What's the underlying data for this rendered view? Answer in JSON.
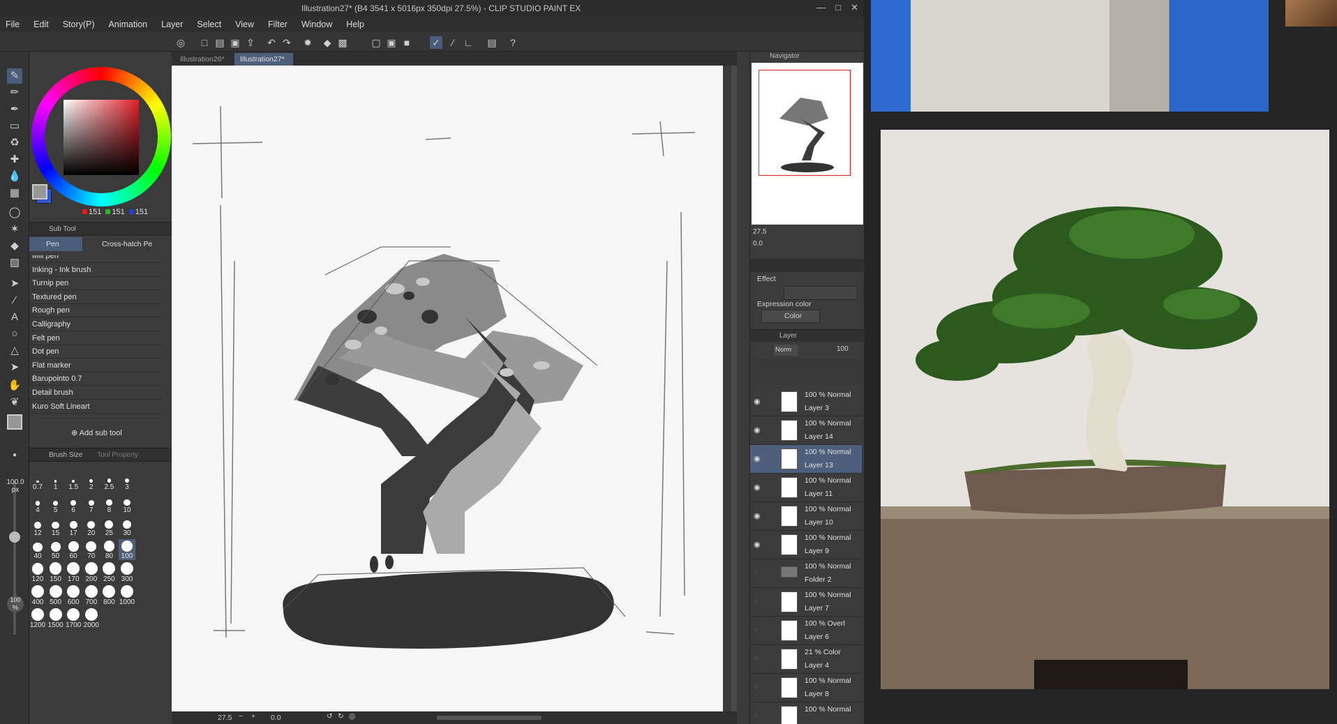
{
  "window": {
    "title": "Illustration27* (B4 3541 x 5016px 350dpi 27.5%) - CLIP STUDIO PAINT EX"
  },
  "menu": [
    "File",
    "Edit",
    "Story(P)",
    "Animation",
    "Layer",
    "Select",
    "View",
    "Filter",
    "Window",
    "Help"
  ],
  "doc_tabs": [
    {
      "label": "Illustration26*",
      "active": false
    },
    {
      "label": "Illustration27*",
      "active": true
    }
  ],
  "color": {
    "r": "151",
    "g": "151",
    "b": "151",
    "main_color": "#979797",
    "sub_color": "#3355cc"
  },
  "sub_tool": {
    "header": "Sub Tool",
    "tabs": [
      "Pen",
      "Cross-hatch Pe"
    ],
    "brushes": [
      "Mili pen",
      "Inking - Ink brush",
      "Turnip pen",
      "Textured pen",
      "Rough pen",
      "Calligraphy",
      "Felt pen",
      "Dot pen",
      "Flat marker",
      "Barupointo 0.7",
      "Detail brush",
      "Kuro Soft Lineart"
    ],
    "add_label": "Add sub tool"
  },
  "brush_size": {
    "tabs": [
      "Brush Size",
      "Tool Property"
    ],
    "current_value": "100.0",
    "unit": "px",
    "opacity": "100",
    "opacity_unit": "%",
    "sizes": [
      "0.7",
      "1",
      "1.5",
      "2",
      "2.5",
      "3",
      "4",
      "5",
      "6",
      "7",
      "8",
      "10",
      "12",
      "15",
      "17",
      "20",
      "25",
      "30",
      "40",
      "50",
      "60",
      "70",
      "80",
      "100",
      "120",
      "150",
      "170",
      "200",
      "250",
      "300",
      "400",
      "500",
      "600",
      "700",
      "800",
      "1000",
      "1200",
      "1500",
      "1700",
      "2000"
    ],
    "selected": "100"
  },
  "canvas_status": {
    "zoom": "27.5",
    "rotation": "0.0"
  },
  "navigator": {
    "title": "Navigator",
    "zoom": "27.5",
    "rotation": "0.0"
  },
  "effect": {
    "label": "Effect",
    "expression_label": "Expression color",
    "expression_value": "Color"
  },
  "layer_panel": {
    "title": "Layer",
    "blend_mode": "Norm",
    "opacity": "100",
    "layers": [
      {
        "mode": "100 % Normal",
        "name": "Layer 3",
        "selected": false,
        "visible": true
      },
      {
        "mode": "100 % Normal",
        "name": "Layer 14",
        "selected": false,
        "visible": true
      },
      {
        "mode": "100 % Normal",
        "name": "Layer 13",
        "selected": true,
        "visible": true
      },
      {
        "mode": "100 % Normal",
        "name": "Layer 11",
        "selected": false,
        "visible": true
      },
      {
        "mode": "100 % Normal",
        "name": "Layer 10",
        "selected": false,
        "visible": true
      },
      {
        "mode": "100 % Normal",
        "name": "Layer 9",
        "selected": false,
        "visible": true
      },
      {
        "mode": "100 % Normal",
        "name": "Folder 2",
        "selected": false,
        "visible": false
      },
      {
        "mode": "100 % Normal",
        "name": "Layer 7",
        "selected": false,
        "visible": false
      },
      {
        "mode": "100 % Overl",
        "name": "Layer 6",
        "selected": false,
        "visible": false
      },
      {
        "mode": "21 % Color",
        "name": "Layer 4",
        "selected": false,
        "visible": false
      },
      {
        "mode": "100 % Normal",
        "name": "Layer 8",
        "selected": false,
        "visible": false
      },
      {
        "mode": "100 % Normal",
        "name": "",
        "selected": false,
        "visible": false
      }
    ]
  }
}
